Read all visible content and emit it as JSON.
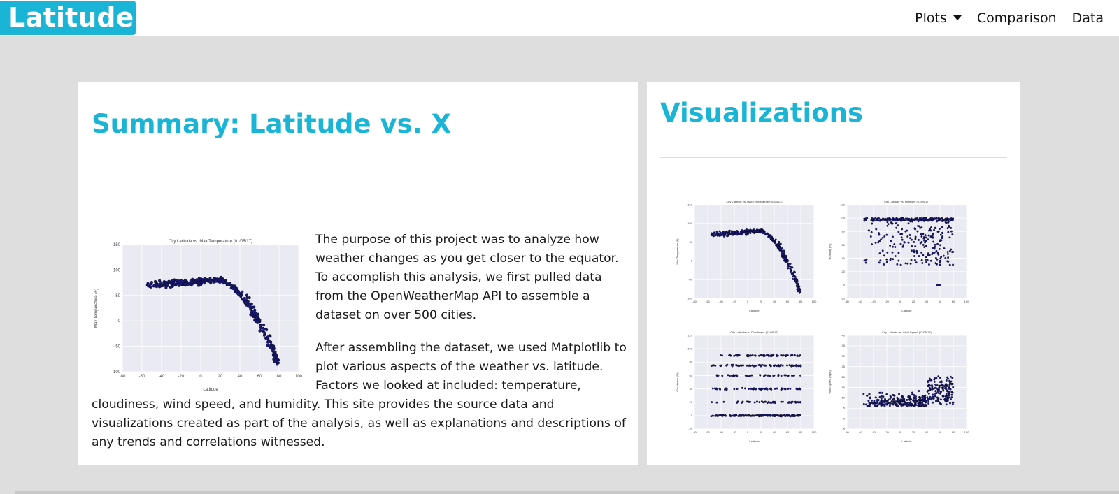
{
  "nav": {
    "brand": "Latitude",
    "items": [
      {
        "label": "Plots",
        "dropdown": true
      },
      {
        "label": "Comparison"
      },
      {
        "label": "Data"
      }
    ]
  },
  "colors": {
    "accent": "#19b4d6",
    "page_bg": "#dedede",
    "points": "#1a1a78",
    "plot_bg": "#eaeaf2"
  },
  "summary": {
    "title": "Summary: Latitude vs. X",
    "paragraph1": "The purpose of this project was to analyze how weather changes as you get closer to the equator. To accomplish this analysis, we first pulled data from the OpenWeatherMap API to assemble a dataset on over 500 cities.",
    "paragraph2": "After assembling the dataset, we used Matplotlib to plot various aspects of the weather vs. latitude. Factors we looked at included: temperature, cloudiness, wind speed, and humidity. This site provides the source data and visualizations created as part of the analysis, as well as explanations and descriptions of any trends and correlations witnessed."
  },
  "visualizations": {
    "title": "Visualizations"
  },
  "chart_data": [
    {
      "type": "scatter",
      "id": "main-temp",
      "title": "City Latitude vs. Max Temperature (01/05/17)",
      "xlabel": "Latitude",
      "ylabel": "Max Temperature (F)",
      "xlim": [
        -80,
        100
      ],
      "ylim": [
        -100,
        150
      ],
      "xticks": [
        -80,
        -60,
        -40,
        -20,
        0,
        20,
        40,
        60,
        80,
        100
      ],
      "yticks": [
        -100,
        -50,
        0,
        50,
        100,
        150
      ],
      "pattern": "temp",
      "grid": true
    },
    {
      "type": "scatter",
      "id": "thumb-temp",
      "title": "City Latitude vs. Max Temperature (01/05/17)",
      "xlabel": "Latitude",
      "ylabel": "Max Temperature (F)",
      "xlim": [
        -80,
        100
      ],
      "ylim": [
        -100,
        150
      ],
      "xticks": [
        -80,
        -60,
        -40,
        -20,
        0,
        20,
        40,
        60,
        80,
        100
      ],
      "yticks": [
        -100,
        -50,
        0,
        50,
        100,
        150
      ],
      "pattern": "temp",
      "grid": true
    },
    {
      "type": "scatter",
      "id": "thumb-humidity",
      "title": "City Latitude vs. Humidity (01/05/17)",
      "xlabel": "Latitude",
      "ylabel": "Humidity (%)",
      "xlim": [
        -80,
        100
      ],
      "ylim": [
        -20,
        120
      ],
      "xticks": [
        -80,
        -60,
        -40,
        -20,
        0,
        20,
        40,
        60,
        80,
        100
      ],
      "yticks": [
        -20,
        0,
        20,
        40,
        60,
        80,
        100,
        120
      ],
      "pattern": "humidity",
      "grid": true
    },
    {
      "type": "scatter",
      "id": "thumb-cloud",
      "title": "City Latitude vs. Cloudiness (01/05/17)",
      "xlabel": "Latitude",
      "ylabel": "Cloudiness (%)",
      "xlim": [
        -80,
        100
      ],
      "ylim": [
        -20,
        120
      ],
      "xticks": [
        -80,
        -60,
        -40,
        -20,
        0,
        20,
        40,
        60,
        80,
        100
      ],
      "yticks": [
        -20,
        0,
        20,
        40,
        60,
        80,
        100,
        120
      ],
      "pattern": "cloud",
      "grid": true
    },
    {
      "type": "scatter",
      "id": "thumb-wind",
      "title": "City Latitude vs. Wind Speed (01/05/17)",
      "xlabel": "Latitude",
      "ylabel": "Wind Speed (mph)",
      "xlim": [
        -80,
        100
      ],
      "ylim": [
        -5,
        40
      ],
      "xticks": [
        -80,
        -60,
        -40,
        -20,
        0,
        20,
        40,
        60,
        80,
        100
      ],
      "yticks": [
        -5,
        0,
        5,
        10,
        15,
        20,
        25,
        30,
        35,
        40
      ],
      "pattern": "wind",
      "grid": true
    }
  ]
}
